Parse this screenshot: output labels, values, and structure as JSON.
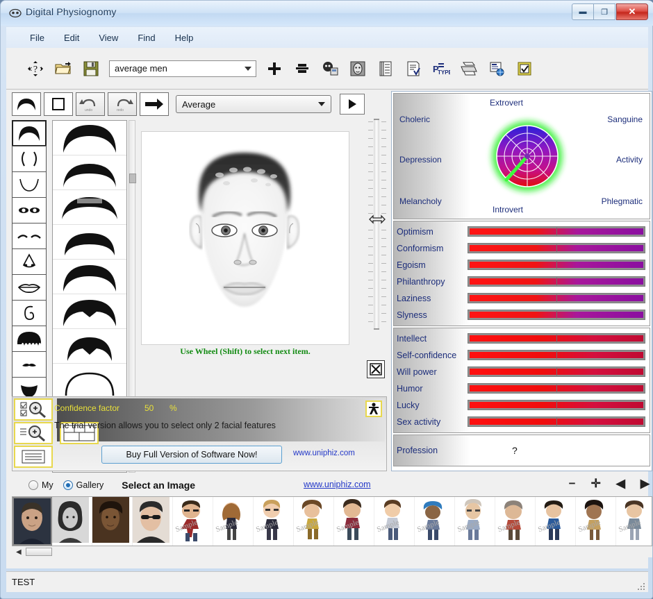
{
  "window": {
    "title": "Digital Physiognomy",
    "icon": "face-icon",
    "buttons": {
      "minimize": "—",
      "maximize": "❐",
      "close": "✕"
    }
  },
  "menu": {
    "items": [
      "File",
      "Edit",
      "View",
      "Find",
      "Help"
    ]
  },
  "toolbar": {
    "preset_value": "average men",
    "icons": [
      "identify-icon",
      "open-folder-icon",
      "save-disk-icon"
    ],
    "icons_right": [
      "add-icon",
      "remove-icon",
      "face-capture-icon",
      "portrait-icon",
      "list-icon",
      "report-icon",
      "ptype-icon",
      "print-icon",
      "export-web-icon",
      "checkbox-task-icon"
    ]
  },
  "editor": {
    "tools": [
      "hair-shape-icon",
      "rectangle-icon",
      "undo-icon",
      "redo-icon",
      "arrow-right-icon"
    ],
    "mode_value": "Average",
    "play_label": "▶",
    "hint": "Use Wheel (Shift) to select next item.",
    "close_icon": "close-cross-icon",
    "features": [
      "hairline-icon",
      "face-sides-icon",
      "chin-icon",
      "eyes-icon",
      "eyebrows-icon",
      "nose-icon",
      "lips-icon",
      "ear-icon",
      "hair-icon",
      "mustache-icon",
      "beard-icon"
    ],
    "thumbnail_count": 8
  },
  "trial": {
    "confidence_label": "Confidence factor",
    "confidence_value": "50",
    "confidence_unit": "%",
    "message": "The trial version allows you to select only 2 facial features",
    "buy_button": "Buy Full Version of Software Now!",
    "url": "www.uniphiz.com",
    "icons": [
      "zoom-in-checks-icon",
      "zoom-in-lines-icon",
      "grid-layout-icon",
      "list-lines-icon",
      "person-icon"
    ]
  },
  "analysis": {
    "temperament": {
      "top": "Extrovert",
      "bottom": "Introvert",
      "left_top": "Choleric",
      "left_mid": "Depression",
      "left_bottom": "Melancholy",
      "right_top": "Sanguine",
      "right_mid": "Activity",
      "right_bottom": "Phlegmatic"
    },
    "traits_group1": [
      {
        "label": "Optimism",
        "value": 100
      },
      {
        "label": "Conformism",
        "value": 100
      },
      {
        "label": "Egoism",
        "value": 100
      },
      {
        "label": "Philanthropy",
        "value": 100
      },
      {
        "label": "Laziness",
        "value": 100
      },
      {
        "label": "Slyness",
        "value": 100
      }
    ],
    "traits_group2": [
      {
        "label": "Intellect",
        "value": 100
      },
      {
        "label": "Self-confidence",
        "value": 100
      },
      {
        "label": "Will power",
        "value": 100
      },
      {
        "label": "Humor",
        "value": 100
      },
      {
        "label": "Lucky",
        "value": 100
      },
      {
        "label": "Sex activity",
        "value": 100
      }
    ],
    "profession": {
      "label": "Profession",
      "value": "?"
    }
  },
  "gallery": {
    "radio_my": "My",
    "radio_gallery": "Gallery",
    "selected_source": "Gallery",
    "title": "Select an Image",
    "url": "www.uniphiz.com",
    "nav": {
      "zoom_out": "−",
      "zoom_in": "✛",
      "prev": "◀",
      "next": "▶"
    },
    "sample_watermark": "Sample",
    "item_count": 17
  },
  "statusbar": {
    "text": "TEST"
  },
  "colors": {
    "title_text": "#1b3a5c",
    "accent_blue": "#2338c8",
    "label_blue": "#1c2d7a",
    "bar_red": "#ff1414",
    "bar_purple": "#8a0fa0",
    "hint_green": "#138b13",
    "confidence_yellow": "#e8e03a"
  }
}
